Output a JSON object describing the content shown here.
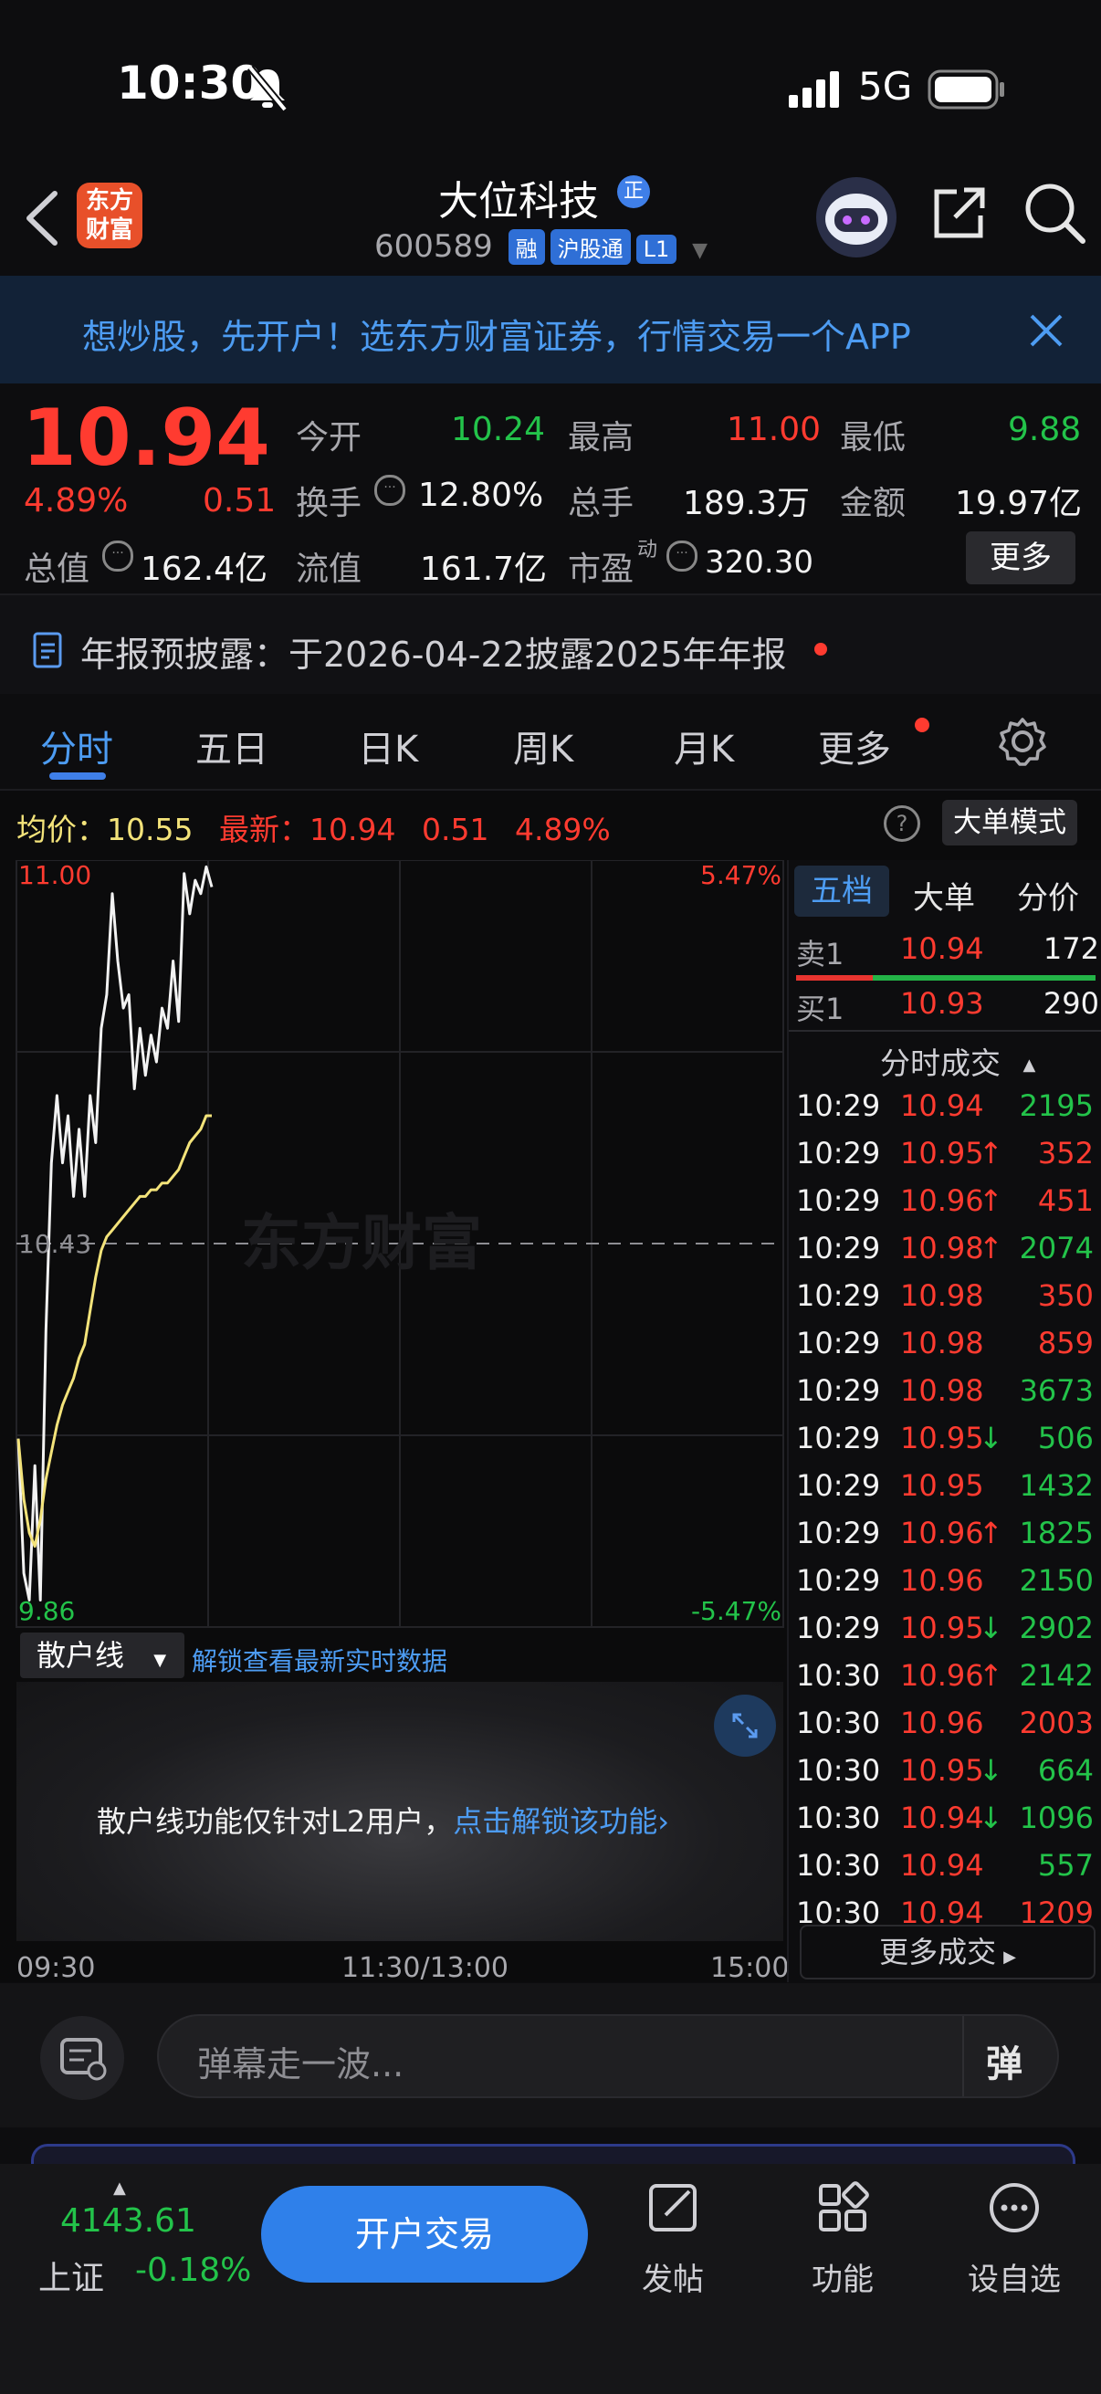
{
  "status_bar": {
    "time": "10:30",
    "network": "5G"
  },
  "nav": {
    "logo_text": "东方\n财富",
    "stock_name": "大位科技",
    "badge_zheng": "正",
    "stock_code": "600589",
    "tags": [
      "融",
      "沪股通",
      "L1"
    ]
  },
  "promo": {
    "text": "想炒股，先开户！选东方财富证券，行情交易一个APP"
  },
  "quote": {
    "price": "10.94",
    "change_pct": "4.89%",
    "change_amt": "0.51",
    "fields": {
      "open_label": "今开",
      "open": "10.24",
      "high_label": "最高",
      "high": "11.00",
      "low_label": "最低",
      "low": "9.88",
      "turnover_label": "换手",
      "turnover": "12.80%",
      "volume_label": "总手",
      "volume": "189.3万",
      "amount_label": "金额",
      "amount": "19.97亿",
      "mktcap_label": "总值",
      "mktcap": "162.4亿",
      "float_label": "流值",
      "float": "161.7亿",
      "pe_label": "市盈",
      "pe_sup": "动",
      "pe": "320.30"
    },
    "more_label": "更多"
  },
  "notice": {
    "text": "年报预披露：于2026-04-22披露2025年年报"
  },
  "tabs": [
    "分时",
    "五日",
    "日K",
    "周K",
    "月K",
    "更多"
  ],
  "chart_header": {
    "avg_label": "均价：",
    "avg": "10.55",
    "latest_label": "最新：",
    "latest": "10.94",
    "chg": "0.51",
    "pct": "4.89%",
    "mode_button": "大单模式"
  },
  "chart_data": {
    "type": "line",
    "ylim": [
      9.86,
      11.0
    ],
    "y_labels": {
      "top": "11.00",
      "mid": "10.43",
      "bottom": "9.86",
      "top_pct": "5.47%",
      "bottom_pct": "-5.47%"
    },
    "x_labels": [
      "09:30",
      "11:30/13:00",
      "15:00"
    ],
    "watermark": "东方财富",
    "series": [
      {
        "color": "#f2f2f2",
        "values": [
          10.14,
          9.94,
          9.9,
          10.1,
          9.9,
          10.3,
          10.55,
          10.65,
          10.55,
          10.62,
          10.5,
          10.6,
          10.5,
          10.65,
          10.58,
          10.75,
          10.8,
          10.95,
          10.85,
          10.78,
          10.8,
          10.66,
          10.75,
          10.68,
          10.74,
          10.7,
          10.78,
          10.75,
          10.85,
          10.76,
          10.98,
          10.92,
          10.97,
          10.95,
          10.99,
          10.96
        ]
      },
      {
        "color": "#f3e37a",
        "values": [
          10.14,
          10.05,
          10.0,
          9.98,
          10.02,
          10.08,
          10.12,
          10.16,
          10.19,
          10.21,
          10.23,
          10.26,
          10.28,
          10.33,
          10.38,
          10.42,
          10.44,
          10.45,
          10.46,
          10.47,
          10.48,
          10.49,
          10.5,
          10.5,
          10.51,
          10.51,
          10.52,
          10.52,
          10.53,
          10.54,
          10.56,
          10.58,
          10.59,
          10.6,
          10.62,
          10.62
        ]
      }
    ]
  },
  "retail_line": {
    "dropdown": "散户线",
    "unlock_link": "解锁查看最新实时数据",
    "message": "散户线功能仅针对L2用户，",
    "message_link": "点击解锁该功能"
  },
  "order_book": {
    "tabs": [
      "五档",
      "大单",
      "分价"
    ],
    "sell": {
      "label": "卖1",
      "price": "10.94",
      "vol": "172"
    },
    "buy": {
      "label": "买1",
      "price": "10.93",
      "vol": "290"
    },
    "ticks_title": "分时成交",
    "ticks": [
      [
        "10:29",
        "10.94",
        "",
        "2195"
      ],
      [
        "10:29",
        "10.95",
        "↑",
        "352"
      ],
      [
        "10:29",
        "10.96",
        "↑",
        "451"
      ],
      [
        "10:29",
        "10.98",
        "↑",
        "2074"
      ],
      [
        "10:29",
        "10.98",
        "",
        "350"
      ],
      [
        "10:29",
        "10.98",
        "",
        "859"
      ],
      [
        "10:29",
        "10.98",
        "",
        "3673"
      ],
      [
        "10:29",
        "10.95",
        "↓",
        "506"
      ],
      [
        "10:29",
        "10.95",
        "",
        "1432"
      ],
      [
        "10:29",
        "10.96",
        "↑",
        "1825"
      ],
      [
        "10:29",
        "10.96",
        "",
        "2150"
      ],
      [
        "10:29",
        "10.95",
        "↓",
        "2902"
      ],
      [
        "10:30",
        "10.96",
        "↑",
        "2142"
      ],
      [
        "10:30",
        "10.96",
        "",
        "2003"
      ],
      [
        "10:30",
        "10.95",
        "↓",
        "664"
      ],
      [
        "10:30",
        "10.94",
        "↓",
        "1096"
      ],
      [
        "10:30",
        "10.94",
        "",
        "557"
      ],
      [
        "10:30",
        "10.94",
        "",
        "1209"
      ]
    ],
    "more_button": "更多成交"
  },
  "comment": {
    "placeholder": "弹幕走一波...",
    "danmu_button": "弹"
  },
  "bottom_bar": {
    "index_value": "4143.61",
    "index_name": "上证",
    "index_pct": "-0.18%",
    "trade_button": "开户交易",
    "items": [
      "发帖",
      "功能",
      "设自选"
    ]
  }
}
